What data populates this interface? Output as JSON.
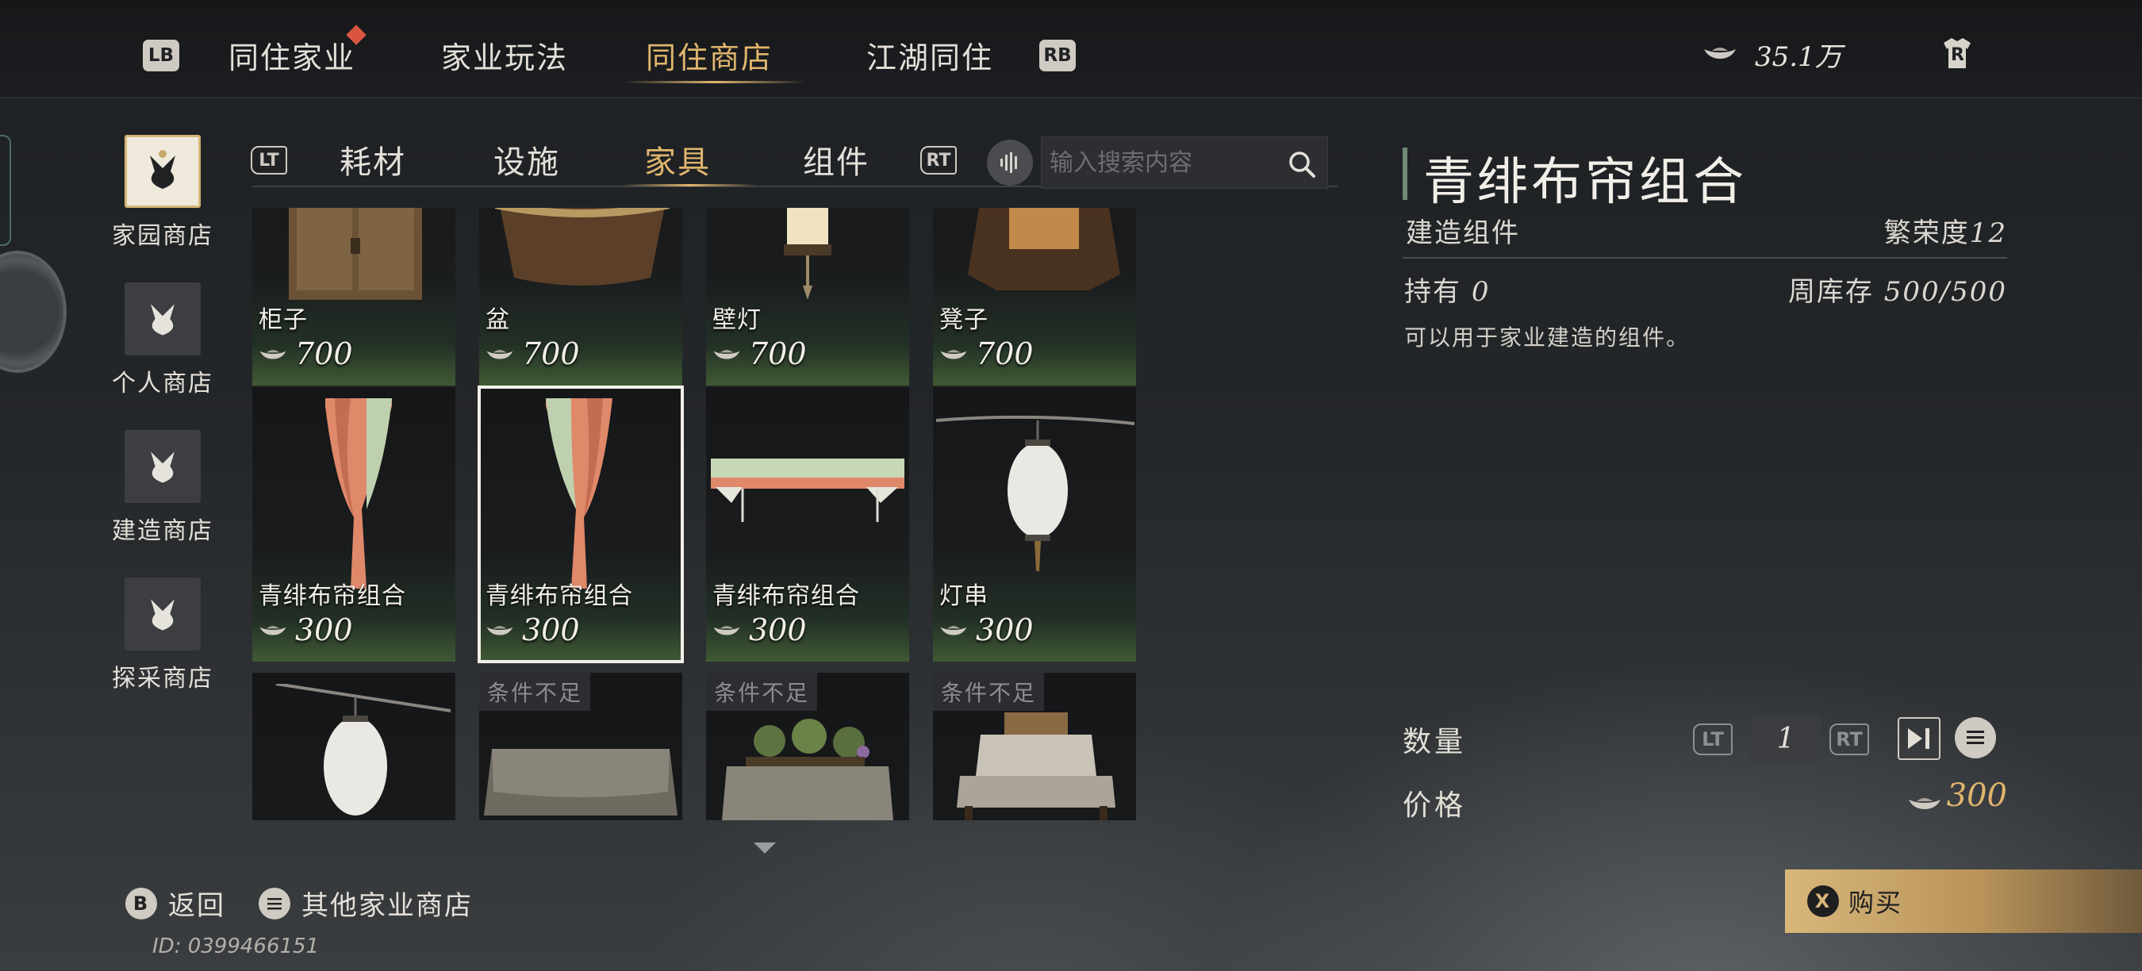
{
  "top_nav": {
    "left_key": "LB",
    "right_key": "RB",
    "tabs": [
      {
        "label": "同住家业"
      },
      {
        "label": "家业玩法"
      },
      {
        "label": "同住商店"
      },
      {
        "label": "江湖同住"
      }
    ],
    "currency_amount": "35.1万",
    "right_icon_key": "R"
  },
  "shop_list": [
    {
      "label": "家园商店",
      "icon": "bundle-icon"
    },
    {
      "label": "个人商店",
      "icon": "bundle-icon"
    },
    {
      "label": "建造商店",
      "icon": "bundle-icon"
    },
    {
      "label": "探采商店",
      "icon": "bundle-icon"
    }
  ],
  "sub_tabs": {
    "left_key": "LT",
    "right_key": "RT",
    "tabs": [
      {
        "label": "耗材"
      },
      {
        "label": "设施"
      },
      {
        "label": "家具"
      },
      {
        "label": "组件"
      }
    ]
  },
  "search": {
    "placeholder": "输入搜索内容"
  },
  "items": [
    {
      "name": "柜子",
      "price": "700",
      "art": "cabinet"
    },
    {
      "name": "盆",
      "price": "700",
      "art": "basin"
    },
    {
      "name": "壁灯",
      "price": "700",
      "art": "wall-lamp"
    },
    {
      "name": "凳子",
      "price": "700",
      "art": "stool"
    },
    {
      "name": "青绯布帘组合",
      "price": "300",
      "art": "curtain-left"
    },
    {
      "name": "青绯布帘组合",
      "price": "300",
      "art": "curtain-right"
    },
    {
      "name": "青绯布帘组合",
      "price": "300",
      "art": "valance"
    },
    {
      "name": "灯串",
      "price": "300",
      "art": "lantern"
    },
    {
      "name": "",
      "price": "",
      "art": "lantern"
    },
    {
      "name": "",
      "price": "",
      "art": "table",
      "locked": "条件不足"
    },
    {
      "name": "",
      "price": "",
      "art": "table-plants",
      "locked": "条件不足"
    },
    {
      "name": "",
      "price": "",
      "art": "table-box",
      "locked": "条件不足"
    }
  ],
  "detail": {
    "title": "青绯布帘组合",
    "type": "建造组件",
    "prosperity_label": "繁荣度",
    "prosperity_value": "12",
    "own_label": "持有",
    "own_value": "0",
    "stock_label": "周库存",
    "stock_value": "500/500",
    "description": "可以用于家业建造的组件。",
    "quantity_label": "数量",
    "quantity_value": "1",
    "qty_left_key": "LT",
    "qty_right_key": "RT",
    "price_label": "价格",
    "price_value": "300"
  },
  "buy": {
    "key": "X",
    "label": "购买"
  },
  "bottom": {
    "back_key": "B",
    "back_label": "返回",
    "other_label": "其他家业商店",
    "player_id": "ID: 0399466151"
  },
  "colors": {
    "accent_gold": "#e0b66e",
    "panel_dark": "#1a1c1e",
    "grass_green": "#3f5a34",
    "buy_gold": "#d9b77a"
  }
}
